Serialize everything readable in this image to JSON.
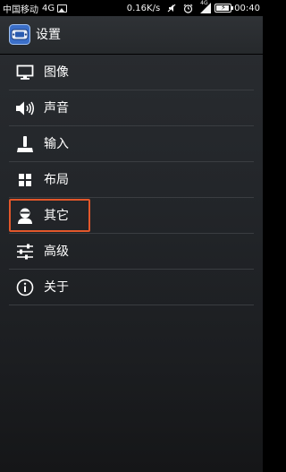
{
  "status_bar": {
    "carrier": "中国移动",
    "network": "4G",
    "speed": "0.16K/s",
    "time": "00:40",
    "signal_label": "4G",
    "battery_level": 0.9
  },
  "action_bar": {
    "title": "设置",
    "app_icon": "gamepad-icon"
  },
  "menu": {
    "items": [
      {
        "label": "图像",
        "icon": "monitor-icon"
      },
      {
        "label": "声音",
        "icon": "speaker-icon"
      },
      {
        "label": "输入",
        "icon": "joystick-icon"
      },
      {
        "label": "布局",
        "icon": "grid-icon"
      },
      {
        "label": "其它",
        "icon": "person-icon",
        "highlighted": true
      },
      {
        "label": "高级",
        "icon": "sliders-icon"
      },
      {
        "label": "关于",
        "icon": "info-icon"
      }
    ]
  },
  "colors": {
    "highlight_border": "#e2572b",
    "background": "#23262a",
    "status_bar": "#000000"
  }
}
